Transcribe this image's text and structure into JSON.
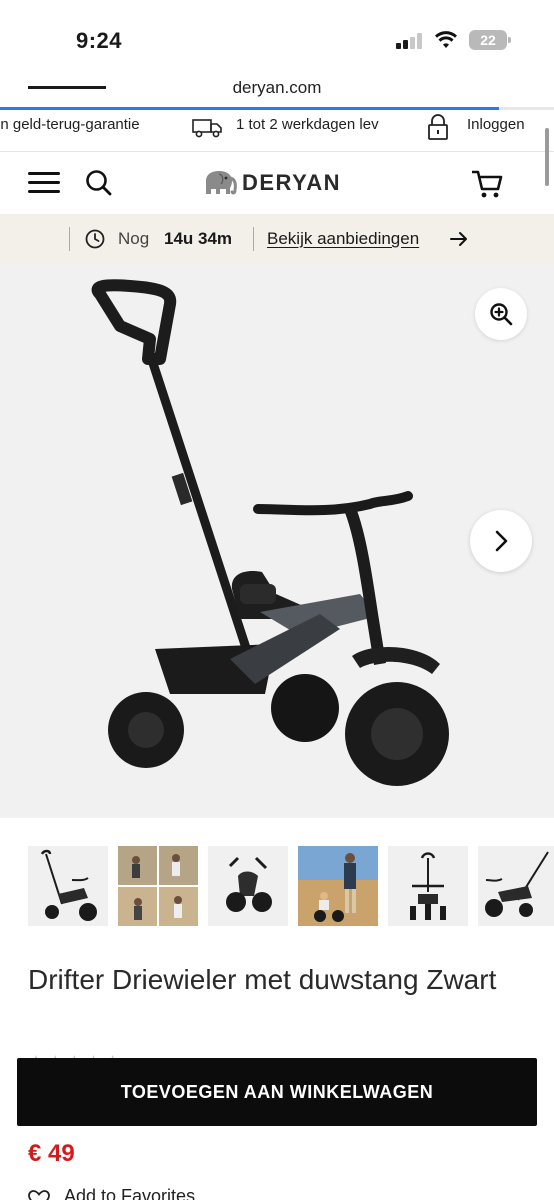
{
  "status_bar": {
    "time": "9:24",
    "battery": "22"
  },
  "browser": {
    "url": "deryan.com",
    "load_progress": 0.9
  },
  "usp_bar": {
    "items": [
      {
        "icon": "money-back-icon",
        "label": "en geld-terug-garantie"
      },
      {
        "icon": "truck-icon",
        "label": "1 tot 2 werkdagen lev"
      }
    ],
    "login_label": "Inloggen",
    "login_icon": "lock-icon"
  },
  "header": {
    "logo_text": "DERYAN",
    "logo_icon": "elephant-icon",
    "menu_icon": "hamburger-icon",
    "search_icon": "search-icon",
    "cart_icon": "cart-icon"
  },
  "countdown": {
    "prefix": "Nog",
    "time_left": "14u 34m",
    "link_label": "Bekijk aanbiedingen",
    "clock_icon": "clock-icon",
    "arrow_icon": "arrow-right-icon"
  },
  "product": {
    "title": "Drifter Driewieler met duwstang Zwart",
    "price": "€ 49",
    "add_to_cart_label": "TOEVOEGEN AAN WINKELWAGEN",
    "favorites_label": "Add to Favorites",
    "thumbnail_count": 6,
    "active_thumbnail": 1
  },
  "colors": {
    "accent_blue": "#2f7bd9",
    "countdown_bg": "#f3efe9",
    "price_red": "#d41b1b",
    "button_black": "#0c0c0c"
  }
}
